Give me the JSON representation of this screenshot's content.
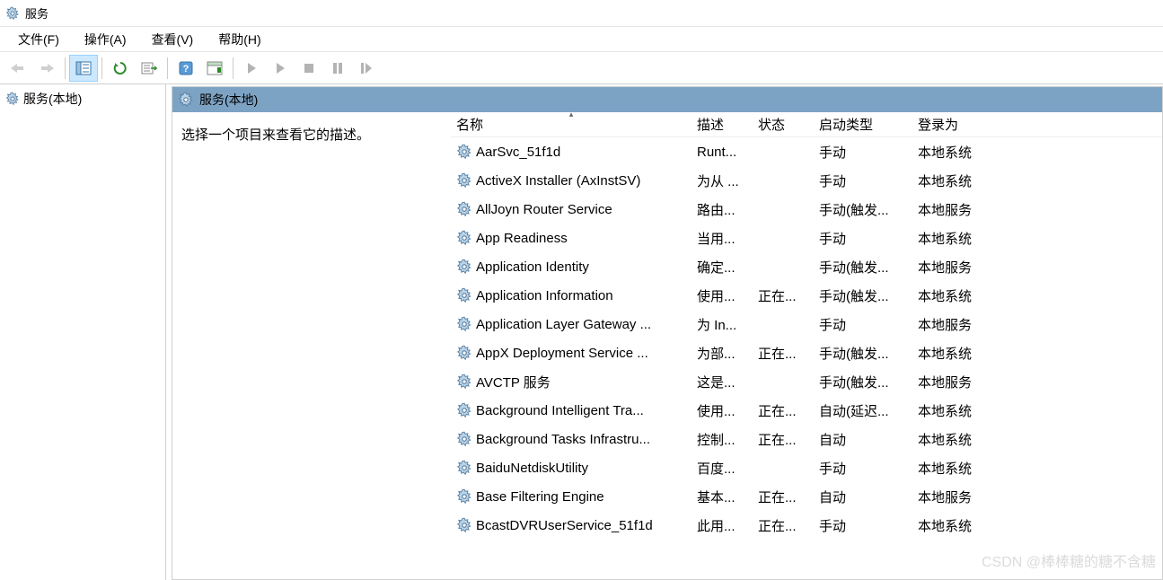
{
  "window": {
    "title": "服务"
  },
  "menu": {
    "file": "文件(F)",
    "action": "操作(A)",
    "view": "查看(V)",
    "help": "帮助(H)"
  },
  "tree": {
    "root": "服务(本地)"
  },
  "content": {
    "title": "服务(本地)",
    "detail_prompt": "选择一个项目来查看它的描述。"
  },
  "columns": {
    "name": "名称",
    "desc": "描述",
    "status": "状态",
    "startup": "启动类型",
    "logon": "登录为"
  },
  "services": [
    {
      "name": "AarSvc_51f1d",
      "desc": "Runt...",
      "status": "",
      "startup": "手动",
      "logon": "本地系统"
    },
    {
      "name": "ActiveX Installer (AxInstSV)",
      "desc": "为从 ...",
      "status": "",
      "startup": "手动",
      "logon": "本地系统"
    },
    {
      "name": "AllJoyn Router Service",
      "desc": "路由...",
      "status": "",
      "startup": "手动(触发...",
      "logon": "本地服务"
    },
    {
      "name": "App Readiness",
      "desc": "当用...",
      "status": "",
      "startup": "手动",
      "logon": "本地系统"
    },
    {
      "name": "Application Identity",
      "desc": "确定...",
      "status": "",
      "startup": "手动(触发...",
      "logon": "本地服务"
    },
    {
      "name": "Application Information",
      "desc": "使用...",
      "status": "正在...",
      "startup": "手动(触发...",
      "logon": "本地系统"
    },
    {
      "name": "Application Layer Gateway ...",
      "desc": "为 In...",
      "status": "",
      "startup": "手动",
      "logon": "本地服务"
    },
    {
      "name": "AppX Deployment Service ...",
      "desc": "为部...",
      "status": "正在...",
      "startup": "手动(触发...",
      "logon": "本地系统"
    },
    {
      "name": "AVCTP 服务",
      "desc": "这是...",
      "status": "",
      "startup": "手动(触发...",
      "logon": "本地服务"
    },
    {
      "name": "Background Intelligent Tra...",
      "desc": "使用...",
      "status": "正在...",
      "startup": "自动(延迟...",
      "logon": "本地系统"
    },
    {
      "name": "Background Tasks Infrastru...",
      "desc": "控制...",
      "status": "正在...",
      "startup": "自动",
      "logon": "本地系统"
    },
    {
      "name": "BaiduNetdiskUtility",
      "desc": "百度...",
      "status": "",
      "startup": "手动",
      "logon": "本地系统"
    },
    {
      "name": "Base Filtering Engine",
      "desc": "基本...",
      "status": "正在...",
      "startup": "自动",
      "logon": "本地服务"
    },
    {
      "name": "BcastDVRUserService_51f1d",
      "desc": "此用...",
      "status": "正在...",
      "startup": "手动",
      "logon": "本地系统"
    }
  ],
  "watermark": "CSDN @棒棒糖的糖不含糖"
}
